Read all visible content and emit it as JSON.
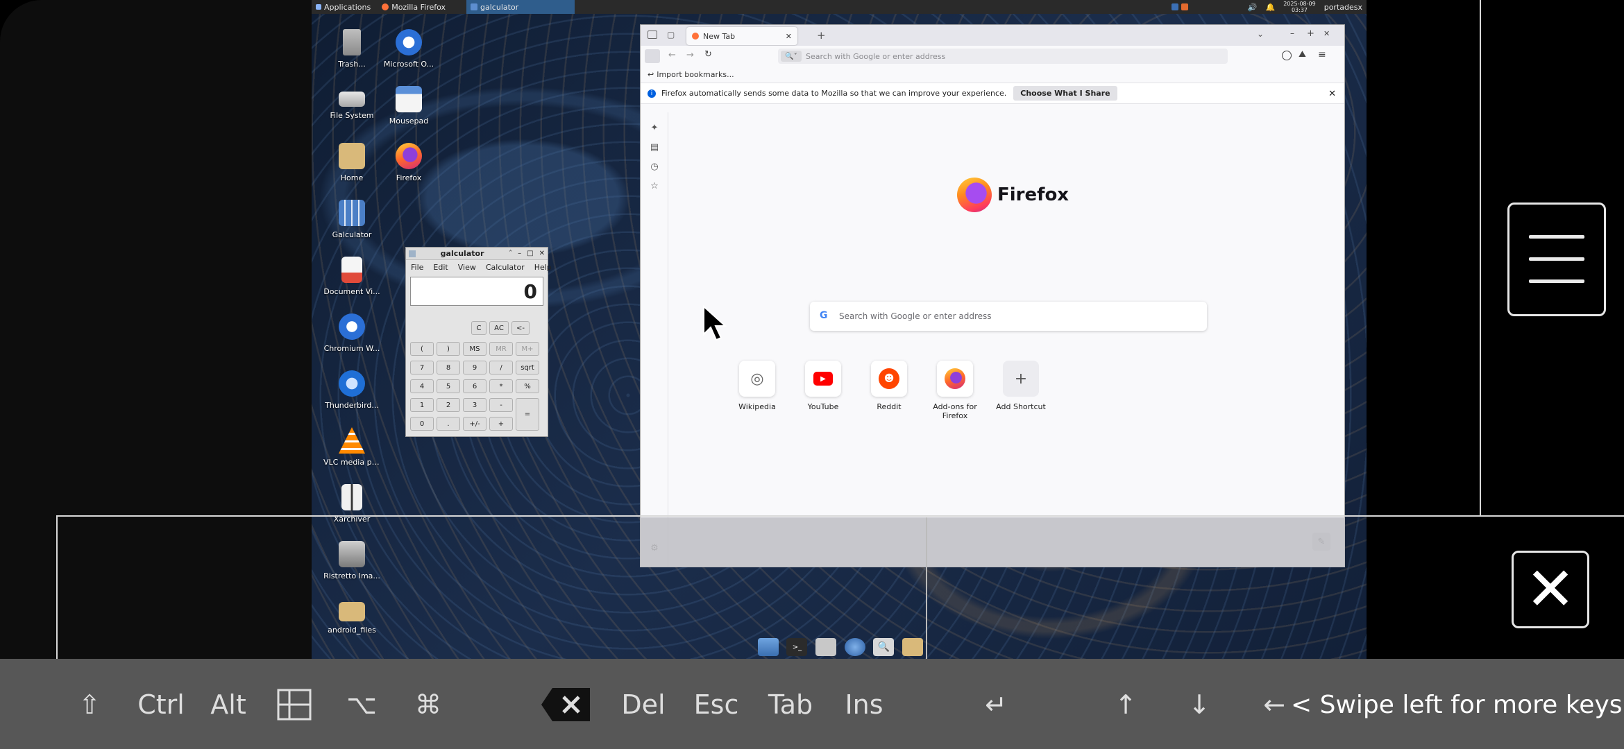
{
  "top_panel": {
    "applications": "Applications",
    "firefox_task": "Mozilla Firefox",
    "galculator_task": "galculator",
    "date": "2025-08-09",
    "time": "03:37",
    "user": "portadesx"
  },
  "desktop_icons": [
    {
      "label": "Trash...",
      "icon": "trash-icon"
    },
    {
      "label": "Microsoft O...",
      "icon": "microsoft-edge-icon"
    },
    {
      "label": "File System",
      "icon": "drive-icon"
    },
    {
      "label": "Mousepad",
      "icon": "mousepad-icon"
    },
    {
      "label": "Home",
      "icon": "home-folder-icon"
    },
    {
      "label": "Firefox",
      "icon": "firefox-icon"
    },
    {
      "label": "Galculator",
      "icon": "calculator-icon"
    },
    {
      "label": "Document Vi...",
      "icon": "document-viewer-icon"
    },
    {
      "label": "Chromium W...",
      "icon": "chromium-icon"
    },
    {
      "label": "Thunderbird...",
      "icon": "thunderbird-icon"
    },
    {
      "label": "VLC media pl...",
      "icon": "vlc-icon"
    },
    {
      "label": "Xarchiver",
      "icon": "archive-icon"
    },
    {
      "label": "Ristretto Ima...",
      "icon": "image-viewer-icon"
    },
    {
      "label": "android_files",
      "icon": "folder-icon"
    }
  ],
  "calculator": {
    "title": "galculator",
    "menu": [
      "File",
      "Edit",
      "View",
      "Calculator",
      "Help"
    ],
    "display": "0",
    "row0": [
      "C",
      "AC",
      "<-"
    ],
    "row1": [
      "(",
      ")",
      "MS",
      "MR",
      "M+"
    ],
    "row2": [
      "7",
      "8",
      "9",
      "/",
      "sqrt"
    ],
    "row3": [
      "4",
      "5",
      "6",
      "*",
      "%"
    ],
    "row4": [
      "1",
      "2",
      "3",
      "-",
      "="
    ],
    "row5": [
      "0",
      ".",
      "+/-",
      "+"
    ]
  },
  "firefox": {
    "tab_title": "New Tab",
    "url_placeholder": "Search with Google or enter address",
    "import_bookmarks": "Import bookmarks...",
    "notice_text": "Firefox automatically sends some data to Mozilla so that we can improve your experience.",
    "notice_button": "Choose What I Share",
    "brand": "Firefox",
    "search_placeholder": "Search with Google or enter address",
    "shortcuts": [
      {
        "label": "Wikipedia",
        "icon": "wikipedia-icon"
      },
      {
        "label": "YouTube",
        "icon": "youtube-icon"
      },
      {
        "label": "Reddit",
        "icon": "reddit-icon"
      },
      {
        "label": "Add-ons for Firefox",
        "icon": "addons-firefox-icon"
      },
      {
        "label": "Add Shortcut",
        "icon": "plus-icon"
      }
    ]
  },
  "keyboard": {
    "keys": [
      "Ctrl",
      "Alt",
      "Del",
      "Esc",
      "Tab",
      "Ins"
    ],
    "swipe_hint": "< Swipe left for more keys"
  },
  "colors": {
    "accent": "#2f5d8c",
    "youtube": "#ff0000",
    "reddit": "#ff4500"
  }
}
